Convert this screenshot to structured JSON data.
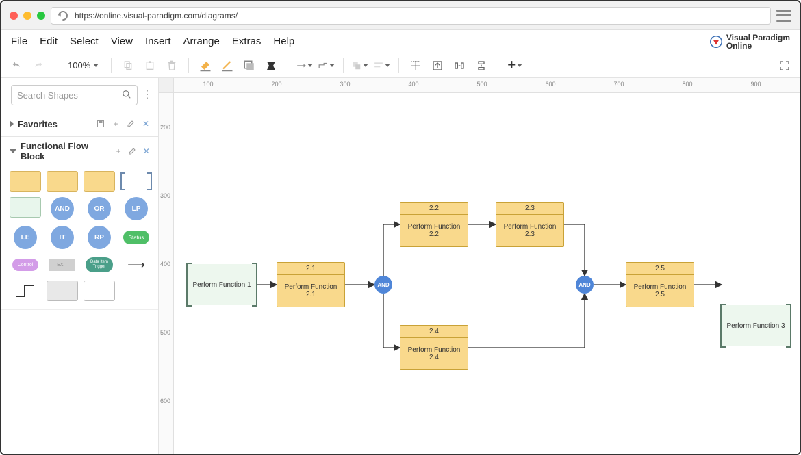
{
  "browser": {
    "url": "https://online.visual-paradigm.com/diagrams/"
  },
  "menu": [
    "File",
    "Edit",
    "Select",
    "View",
    "Insert",
    "Arrange",
    "Extras",
    "Help"
  ],
  "brand": {
    "line1": "Visual Paradigm",
    "line2": "Online"
  },
  "toolbar": {
    "zoom": "100%"
  },
  "sidebar": {
    "search_placeholder": "Search Shapes",
    "section_favorites": "Favorites",
    "section_ffb": "Functional Flow Block",
    "palette": {
      "and": "AND",
      "or": "OR",
      "lp": "LP",
      "le": "LE",
      "it": "IT",
      "rp": "RP",
      "status": "Status",
      "control": "Control",
      "exit": "EXIT",
      "trigger": "Data Item Trigger"
    }
  },
  "ruler_h": [
    "100",
    "200",
    "300",
    "400",
    "500",
    "600",
    "700",
    "800",
    "900"
  ],
  "ruler_v": [
    "200",
    "300",
    "400",
    "500",
    "600"
  ],
  "diagram": {
    "ref1": "Perform Function 1",
    "ref3": "Perform Function 3",
    "n21_id": "2.1",
    "n21": "Perform Function 2.1",
    "n22_id": "2.2",
    "n22": "Perform Function 2.2",
    "n23_id": "2.3",
    "n23": "Perform Function 2.3",
    "n24_id": "2.4",
    "n24": "Perform Function 2.4",
    "n25_id": "2.5",
    "n25": "Perform Function 2.5",
    "and": "AND"
  }
}
